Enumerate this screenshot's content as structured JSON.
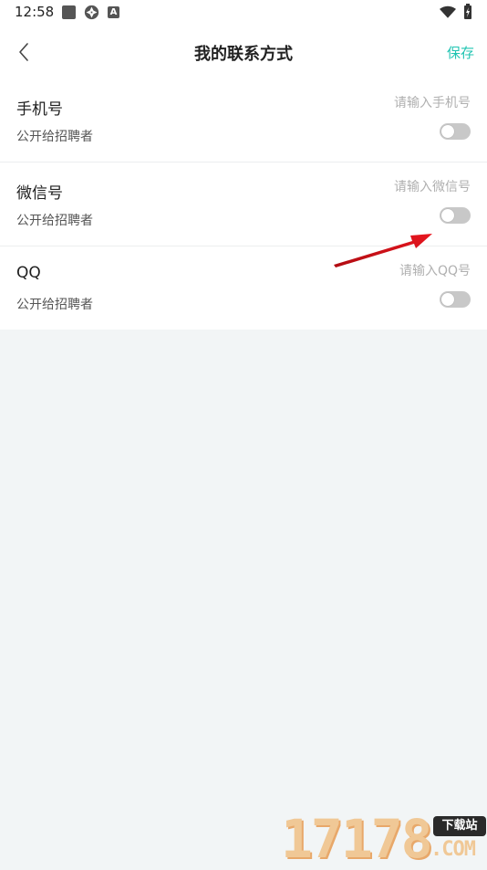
{
  "status_bar": {
    "time": "12:58",
    "notification_badge": "A",
    "icons": [
      "square-icon",
      "aperture-icon",
      "a-badge-icon",
      "wifi-icon",
      "battery-charging-icon"
    ]
  },
  "nav": {
    "back_icon": "chevron-left-icon",
    "title": "我的联系方式",
    "save_label": "保存",
    "accent_color": "#20c4b2"
  },
  "contacts": [
    {
      "label": "手机号",
      "placeholder": "请输入手机号",
      "value": "",
      "public_label": "公开给招聘者",
      "public": false
    },
    {
      "label": "微信号",
      "placeholder": "请输入微信号",
      "value": "",
      "public_label": "公开给招聘者",
      "public": false
    },
    {
      "label": "QQ",
      "placeholder": "请输入QQ号",
      "value": "",
      "public_label": "公开给招聘者",
      "public": false
    }
  ],
  "annotation": {
    "icon": "red-arrow-icon",
    "color": "#d0121a"
  },
  "watermark": {
    "digits": "17178",
    "badge": "下载站",
    "suffix": ".COM"
  }
}
